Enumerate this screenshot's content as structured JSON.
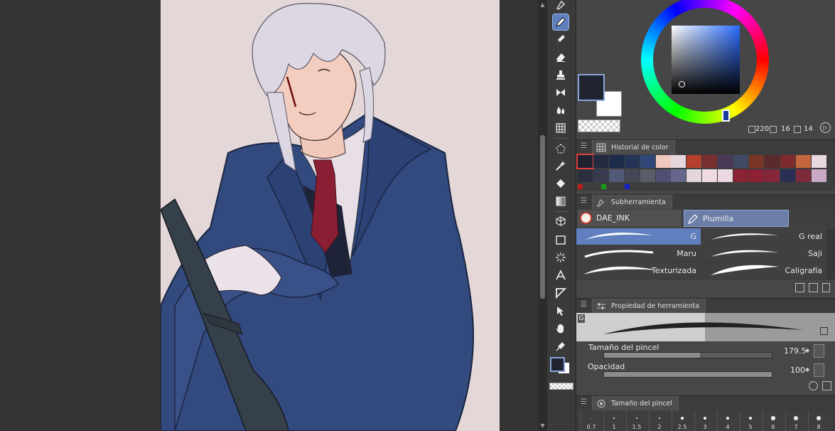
{
  "colors": {
    "main": "#1f2330",
    "sub": "#ffffff",
    "accent": "#5f7fbf",
    "canvas": "#e4d7d8"
  },
  "color_wheel": {
    "h_value": "220",
    "s_value": "16",
    "v_value": "14"
  },
  "color_history": {
    "title": "Historial de color",
    "row1": [
      "#1f2330",
      "#232a3f",
      "#1d2b4a",
      "#243459",
      "#2f4879",
      "#f0c7bf",
      "#e6d6db",
      "#b5402d",
      "#7a2f2f",
      "#4b3a57",
      "#404a64",
      "#7a3525",
      "#5a2a2c",
      "#7c2a2b",
      "#c3653d",
      "#e8d8e0"
    ],
    "row2": [
      "#2b2f3d",
      "#363b4d",
      "#505978",
      "#454957",
      "#5a5d67",
      "#4e4f72",
      "#64668c",
      "#e5d5dd",
      "#f0dbe3",
      "#ead9e2",
      "#8a2334",
      "#8e2035",
      "#85263a",
      "#2a2e52",
      "#7d2a3b",
      "#c9a9c5"
    ],
    "markers": [
      "#c01b1b",
      "#1a9a1a",
      "#1a22d0"
    ]
  },
  "sub_tool": {
    "title": "Subherramienta",
    "groups": [
      "DAE_INK",
      "Plumilla"
    ],
    "brushes": [
      {
        "label": "G",
        "selected": true
      },
      {
        "label": "G real",
        "selected": false
      },
      {
        "label": "Maru",
        "selected": false
      },
      {
        "label": "Saji",
        "selected": false
      },
      {
        "label": "Texturizada",
        "selected": false
      },
      {
        "label": "Caligrafía",
        "selected": false
      }
    ]
  },
  "tool_property": {
    "title": "Propiedad de herramienta",
    "preview_tag": "G",
    "brush_size_label": "Tamaño del pincel",
    "brush_size_value": "179.5",
    "brush_size_level": 0.57,
    "opacity_label": "Opacidad",
    "opacity_value": "100",
    "opacity_level": 1.0
  },
  "brush_size_panel": {
    "title": "Tamaño del pincel",
    "sizes": [
      "0.7",
      "1",
      "1.5",
      "2",
      "2.5",
      "3",
      "4",
      "5",
      "6",
      "7",
      "8"
    ]
  },
  "toolbar": {
    "tools": [
      "pen-nib-icon",
      "pen-icon",
      "pencil-icon",
      "eraser-icon",
      "stamp-icon",
      "decoration-icon",
      "blend-icon",
      "mesh-icon",
      "selection-icon",
      "magic-wand-icon",
      "fill-icon",
      "gradient-icon",
      "3d-object-icon",
      "rectangle-icon",
      "burst-icon",
      "text-icon",
      "ruler-icon",
      "object-select-icon",
      "hand-icon",
      "eyedropper-icon"
    ]
  }
}
